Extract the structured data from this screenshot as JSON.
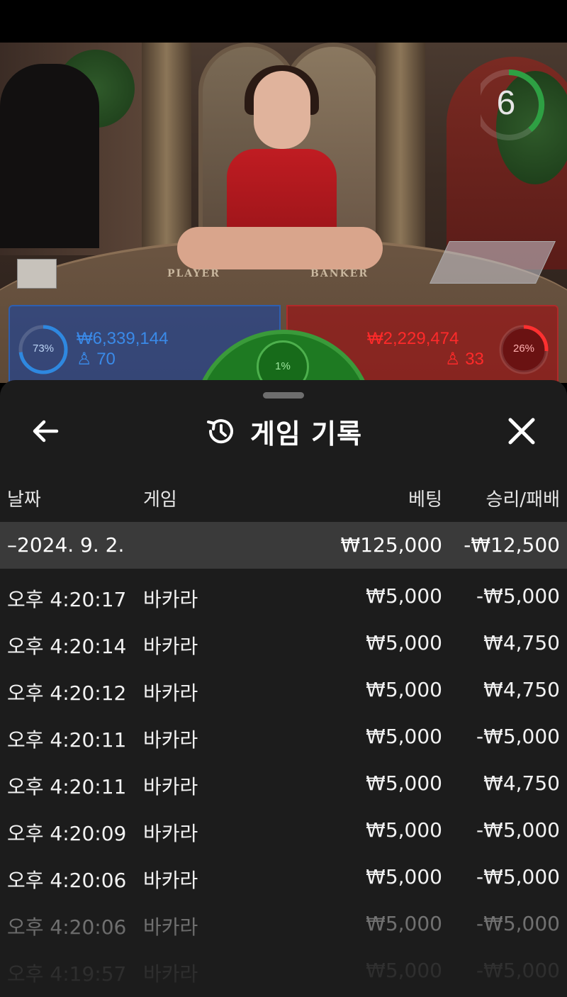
{
  "game": {
    "timer": "6",
    "table_labels": {
      "player": "PLAYER",
      "banker": "BANKER"
    },
    "player": {
      "percent": "73%",
      "percent_value": 0.73,
      "amount": "₩6,339,144",
      "count": "70",
      "color": "#2e6cd0"
    },
    "banker": {
      "percent": "26%",
      "percent_value": 0.26,
      "amount": "₩2,229,474",
      "count": "33",
      "color": "#d8282a"
    },
    "tie": {
      "percent": "1%",
      "percent_value": 0.01,
      "color": "#2e9a32"
    }
  },
  "history": {
    "title": "게임 기록",
    "icons": {
      "back": "arrow-left-icon",
      "history": "history-icon",
      "close": "close-icon"
    },
    "columns": {
      "date": "날짜",
      "game": "게임",
      "bet": "베팅",
      "result": "승리/패배"
    },
    "summary": {
      "date": "–2024. 9. 2.",
      "bet": "₩125,000",
      "result": "-₩12,500"
    },
    "rows": [
      {
        "time": "오후 4:20:17",
        "game": "바카라",
        "bet": "₩5,000",
        "result": "-₩5,000"
      },
      {
        "time": "오후 4:20:14",
        "game": "바카라",
        "bet": "₩5,000",
        "result": "₩4,750"
      },
      {
        "time": "오후 4:20:12",
        "game": "바카라",
        "bet": "₩5,000",
        "result": "₩4,750"
      },
      {
        "time": "오후 4:20:11",
        "game": "바카라",
        "bet": "₩5,000",
        "result": "-₩5,000"
      },
      {
        "time": "오후 4:20:11",
        "game": "바카라",
        "bet": "₩5,000",
        "result": "₩4,750"
      },
      {
        "time": "오후 4:20:09",
        "game": "바카라",
        "bet": "₩5,000",
        "result": "-₩5,000"
      },
      {
        "time": "오후 4:20:06",
        "game": "바카라",
        "bet": "₩5,000",
        "result": "-₩5,000"
      },
      {
        "time": "오후 4:20:06",
        "game": "바카라",
        "bet": "₩5,000",
        "result": "-₩5,000"
      },
      {
        "time": "오후 4:19:57",
        "game": "바카라",
        "bet": "₩5,000",
        "result": "-₩5,000"
      }
    ]
  }
}
